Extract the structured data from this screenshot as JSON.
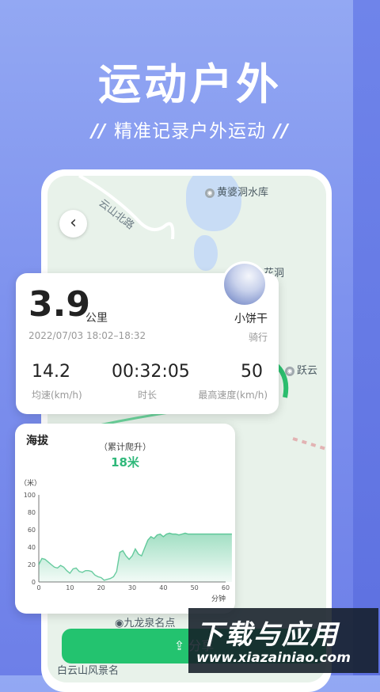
{
  "headline": "运动户外",
  "subheadline": "精准记录户外运动",
  "sub_decor": "//",
  "map": {
    "road_label": "云山北路",
    "poi_reservoir": "黄婆洞水库",
    "poi_huadong": "花洞",
    "poi_yueyun": "跃云",
    "poi_jiulong": "九龙泉名点",
    "poi_baiyun": "白云山风景名"
  },
  "stats": {
    "distance_value": "3.9",
    "distance_unit": "公里",
    "datetime": "2022/07/03 18:02–18:32",
    "user_name": "小饼干",
    "activity_type": "骑行",
    "avg_speed_value": "14.2",
    "avg_speed_label": "均速(km/h)",
    "duration_value": "00:32:05",
    "duration_label": "时长",
    "max_speed_value": "50",
    "max_speed_label": "最高速度(km/h)"
  },
  "elevation": {
    "title": "海拔",
    "subtitle": "（累计爬升）",
    "climb_value": "18米",
    "y_axis_unit": "（米）",
    "x_axis_unit": "分钟"
  },
  "chart_data": {
    "type": "area",
    "xlabel": "分钟",
    "ylabel": "（米）",
    "xlim": [
      0,
      60
    ],
    "ylim": [
      0,
      100
    ],
    "x_ticks": [
      0,
      10,
      20,
      30,
      40,
      50,
      60
    ],
    "y_ticks": [
      0,
      20,
      40,
      60,
      80,
      100
    ],
    "grid": false,
    "series": [
      {
        "color": "#2fb87a",
        "x": [
          0,
          1,
          2,
          3,
          4,
          5,
          6,
          7,
          8,
          9,
          10,
          11,
          12,
          13,
          14,
          15,
          16,
          17,
          18,
          19,
          20,
          21,
          22,
          23,
          24,
          25,
          26,
          27,
          28,
          29,
          30,
          31,
          32,
          33,
          34,
          35,
          36,
          37,
          38,
          39,
          40,
          41,
          42,
          43,
          44,
          45,
          46,
          47,
          48,
          49,
          50,
          52,
          54,
          56,
          58,
          60,
          62
        ],
        "y": [
          20,
          27,
          26,
          23,
          20,
          17,
          16,
          19,
          17,
          13,
          10,
          15,
          16,
          12,
          11,
          13,
          13,
          12,
          8,
          6,
          5,
          2,
          3,
          4,
          6,
          12,
          34,
          36,
          30,
          26,
          30,
          38,
          32,
          30,
          39,
          48,
          52,
          50,
          54,
          55,
          52,
          55,
          56,
          55,
          55,
          54,
          55,
          56,
          55,
          55,
          55,
          55,
          55,
          55,
          55,
          55,
          55
        ]
      }
    ]
  },
  "share_label": "分享",
  "watermark": {
    "cn": "下载与应用",
    "en": "www.xiazainiao.com"
  },
  "colors": {
    "accent_green": "#23c36f",
    "background": "#7e92ee"
  }
}
